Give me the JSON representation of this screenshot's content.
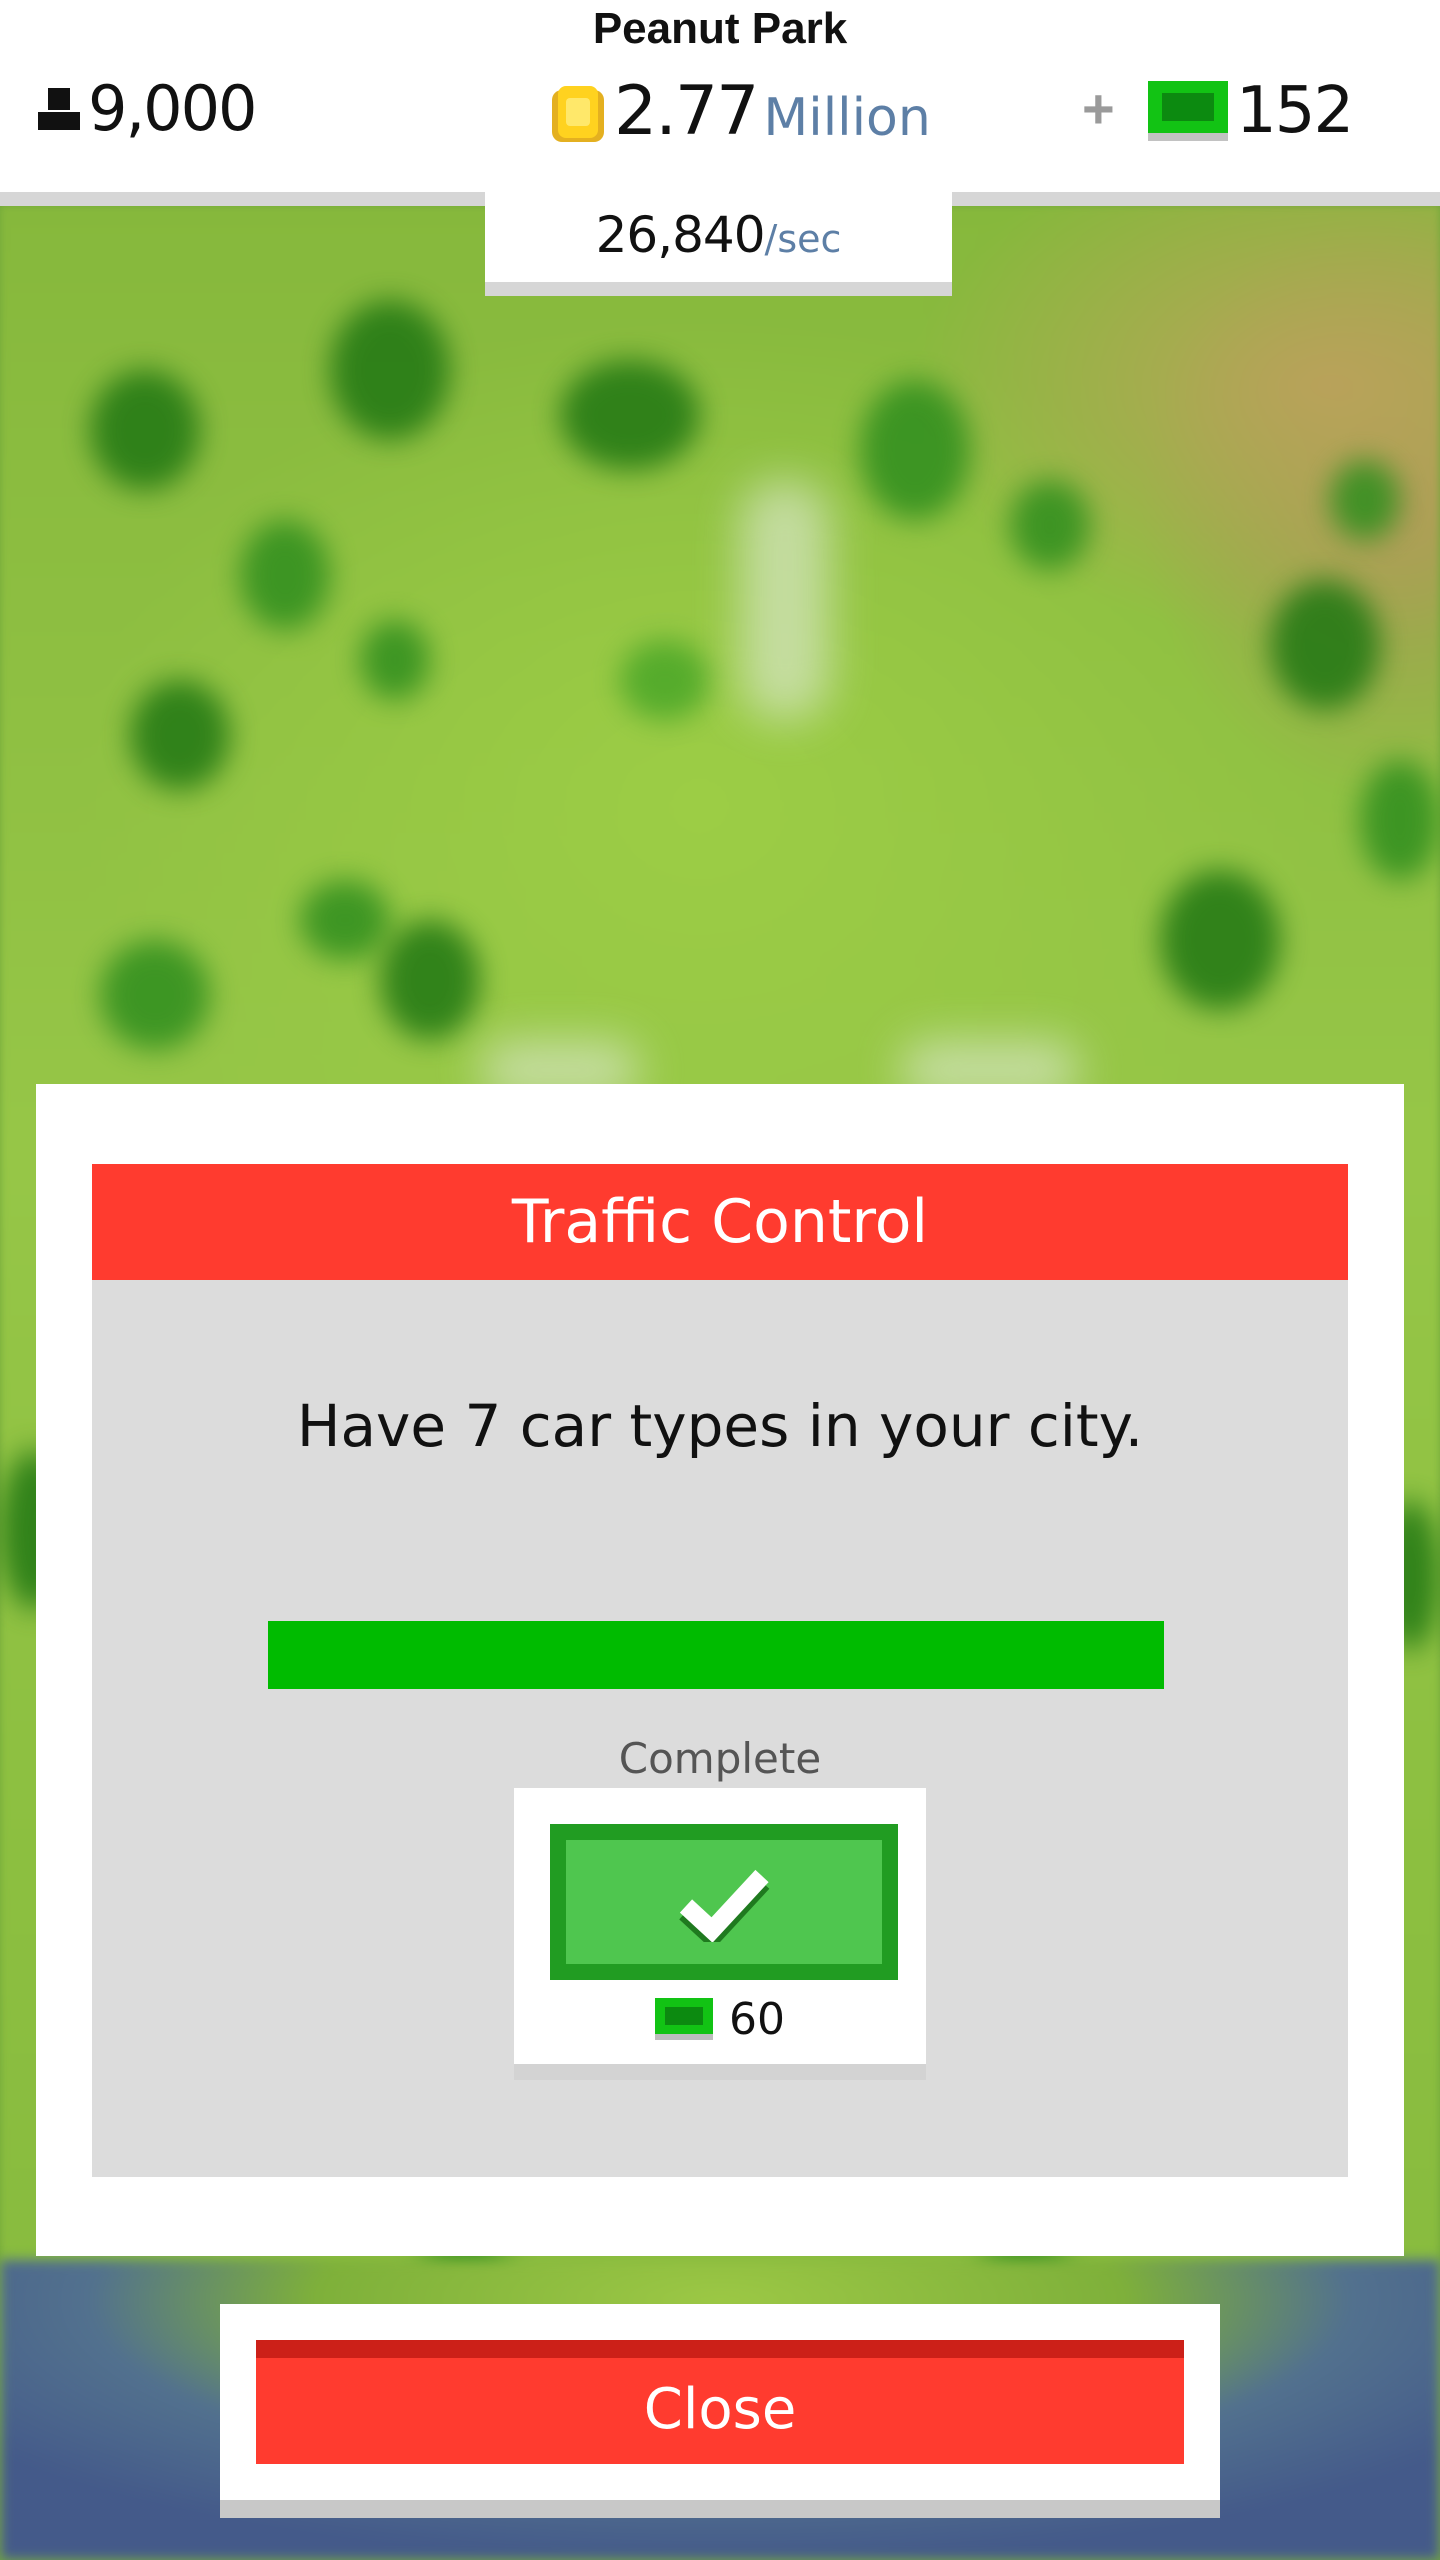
{
  "header": {
    "city_name": "Peanut Park",
    "population": "9,000",
    "money_value": "2.77",
    "money_unit": "Million",
    "cash": "152",
    "income_value": "26,840",
    "income_unit": "/sec",
    "icons": [
      "person-icon",
      "coin-icon",
      "plus-icon",
      "cash-icon"
    ]
  },
  "dialog": {
    "title": "Traffic Control",
    "description": "Have 7 car types in your city.",
    "progress": 1.0,
    "status": "Complete",
    "reward_amount": "60",
    "claim_icon": "checkmark-icon"
  },
  "footer": {
    "close_label": "Close"
  },
  "colors": {
    "header_red": "#ff3b2f",
    "progress_green": "#00bb00",
    "claim_green": "#4fc64f",
    "cash_green": "#12c314",
    "money_unit_blue": "#5d7fa6"
  }
}
